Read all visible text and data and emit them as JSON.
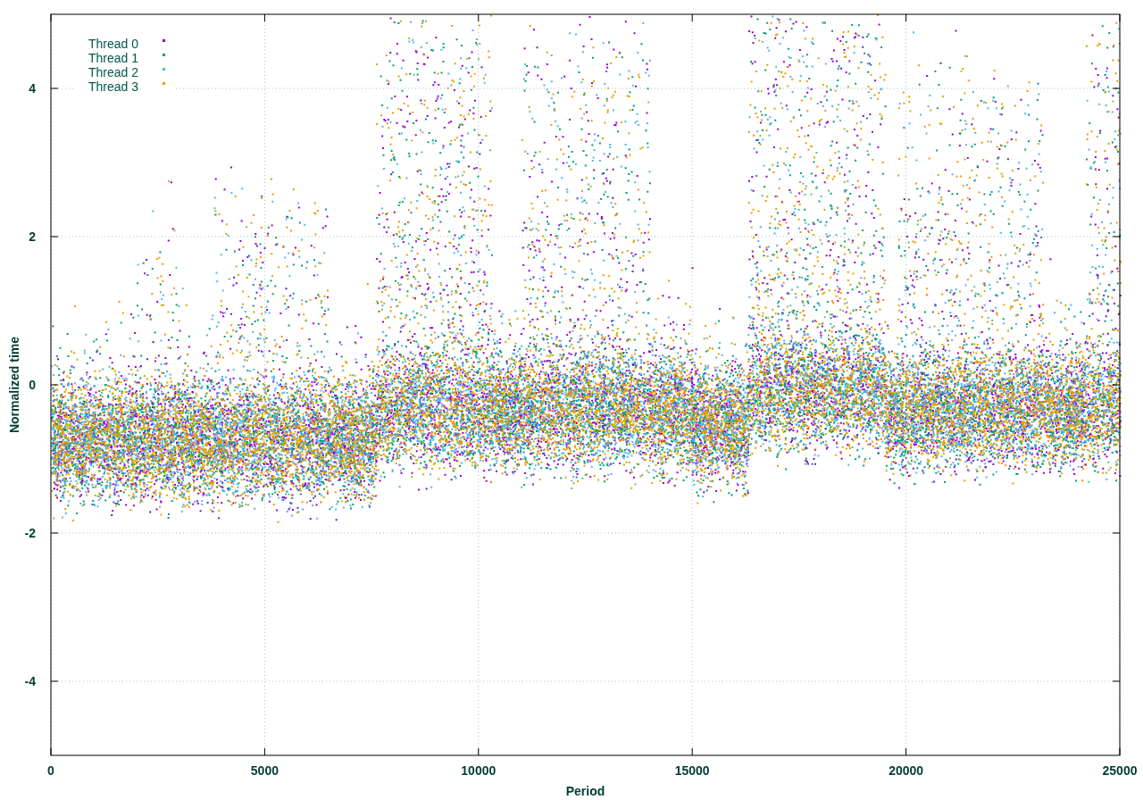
{
  "plot": {
    "kind": "scatter",
    "grid": true,
    "x_axis": {
      "title": "Period",
      "ticks": [
        "0",
        "5000",
        "10000",
        "15000",
        "20000",
        "25000"
      ]
    },
    "y_axis": {
      "title": "Normalized time",
      "ticks": [
        "4",
        "2",
        "0",
        "-2",
        "-4"
      ]
    },
    "legend": [
      {
        "label": "Thread 0",
        "color": "#9400d3"
      },
      {
        "label": "Thread 1",
        "color": "#009e73"
      },
      {
        "label": "Thread 2",
        "color": "#56b4e9"
      },
      {
        "label": "Thread 3",
        "color": "#e69f00"
      }
    ]
  }
}
